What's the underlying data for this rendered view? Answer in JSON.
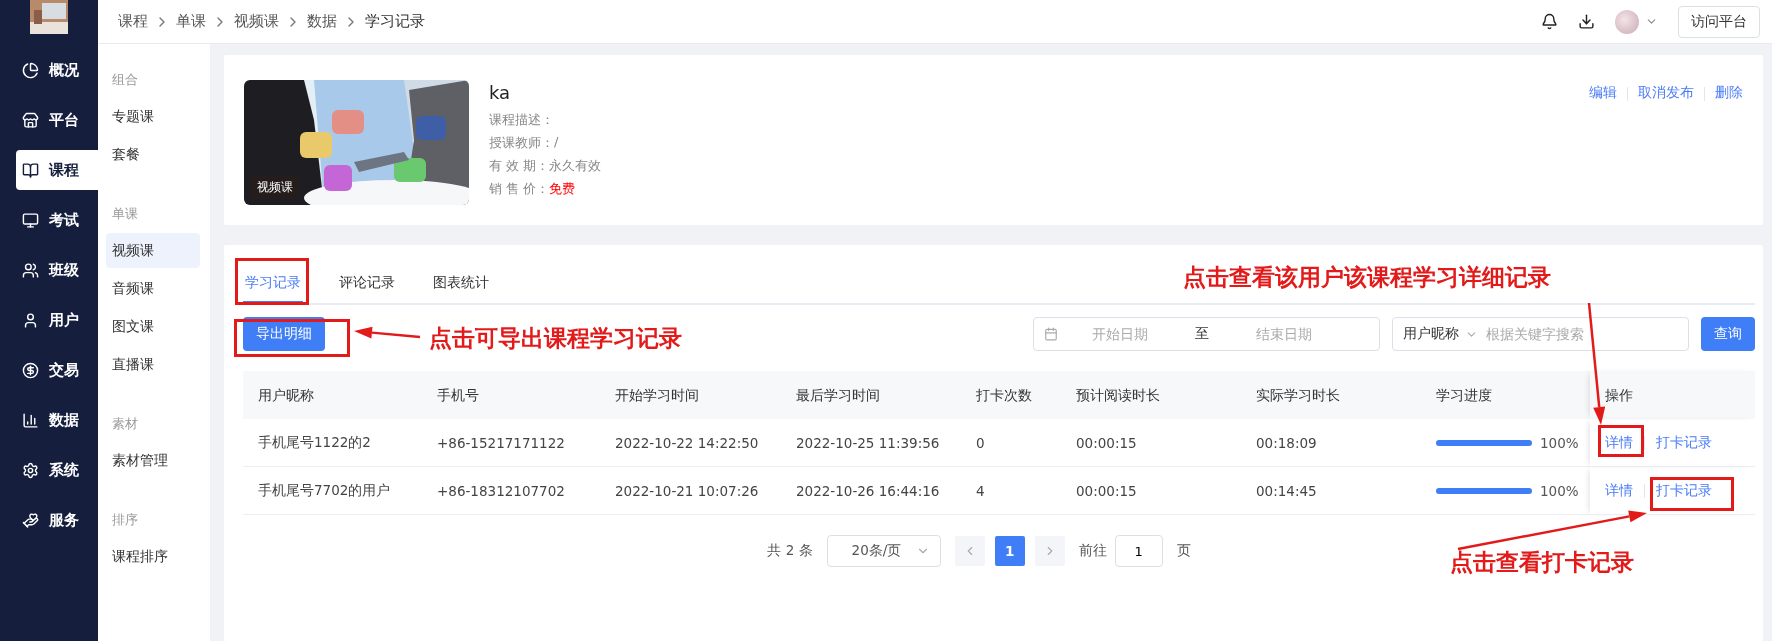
{
  "nav": {
    "items": [
      {
        "label": "概况",
        "selected": false
      },
      {
        "label": "平台",
        "selected": false
      },
      {
        "label": "课程",
        "selected": true
      },
      {
        "label": "考试",
        "selected": false
      },
      {
        "label": "班级",
        "selected": false
      },
      {
        "label": "用户",
        "selected": false
      },
      {
        "label": "交易",
        "selected": false
      },
      {
        "label": "数据",
        "selected": false
      },
      {
        "label": "系统",
        "selected": false
      },
      {
        "label": "服务",
        "selected": false
      }
    ]
  },
  "breadcrumb": [
    "课程",
    "单课",
    "视频课",
    "数据",
    "学习记录"
  ],
  "header": {
    "visit_button": "访问平台"
  },
  "subnav": {
    "groups": [
      {
        "title": "组合",
        "items": [
          {
            "label": "专题课",
            "selected": false
          },
          {
            "label": "套餐",
            "selected": false
          }
        ]
      },
      {
        "title": "单课",
        "items": [
          {
            "label": "视频课",
            "selected": true
          },
          {
            "label": "音频课",
            "selected": false
          },
          {
            "label": "图文课",
            "selected": false
          },
          {
            "label": "直播课",
            "selected": false
          }
        ]
      },
      {
        "title": "素材",
        "items": [
          {
            "label": "素材管理",
            "selected": false
          }
        ]
      },
      {
        "title": "排序",
        "items": [
          {
            "label": "课程排序",
            "selected": false
          }
        ]
      }
    ]
  },
  "course": {
    "badge": "视频课",
    "title": "ka",
    "fields": [
      {
        "label": "课程描述："
      },
      {
        "label": "授课教师：",
        "value": "/"
      },
      {
        "label": "有 效 期：",
        "value": "永久有效"
      },
      {
        "label": "销 售 价：",
        "value": "免费",
        "kind": "price"
      }
    ],
    "actions": [
      "编辑",
      "取消发布",
      "删除"
    ]
  },
  "tabs": [
    {
      "label": "学习记录",
      "selected": true
    },
    {
      "label": "评论记录",
      "selected": false
    },
    {
      "label": "图表统计",
      "selected": false
    }
  ],
  "export_button": "导出明细",
  "date_range": {
    "start_placeholder": "开始日期",
    "separator": "至",
    "end_placeholder": "结束日期"
  },
  "search": {
    "field_select": "用户昵称",
    "placeholder": "根据关键字搜索",
    "button": "查询"
  },
  "table": {
    "columns": [
      "用户昵称",
      "手机号",
      "开始学习时间",
      "最后学习时间",
      "打卡次数",
      "预计阅读时长",
      "实际学习时长",
      "学习进度",
      "操作"
    ],
    "rows": [
      {
        "cells": [
          "手机尾号1122的2",
          "+86-15217171122",
          "2022-10-22 14:22:50",
          "2022-10-25 11:39:56",
          "0",
          "00:00:15",
          "00:18:09"
        ],
        "level": 1,
        "reading": "100%",
        "actions": [
          "详情",
          "打卡记录"
        ]
      },
      {
        "cells": [
          "手机尾号7702的用户",
          "+86-18312107702",
          "2022-10-21 10:07:26",
          "2022-10-26 16:44:16",
          "4",
          "00:00:15",
          "00:14:45"
        ],
        "level": 1,
        "reading": "100%",
        "actions": [
          "详情",
          "打卡记录"
        ]
      }
    ]
  },
  "pagination": {
    "total": "共 2 条",
    "page_size": "20条/页",
    "pages": [
      {
        "label": "1",
        "selected": true
      }
    ],
    "goto_label": "前往",
    "goto_value": "1",
    "goto_suffix": "页"
  },
  "annotations": [
    {
      "text": "点击可导出课程学习记录"
    },
    {
      "text": "点击查看该用户该课程学习详细记录"
    },
    {
      "text": "点击查看打卡记录"
    }
  ]
}
